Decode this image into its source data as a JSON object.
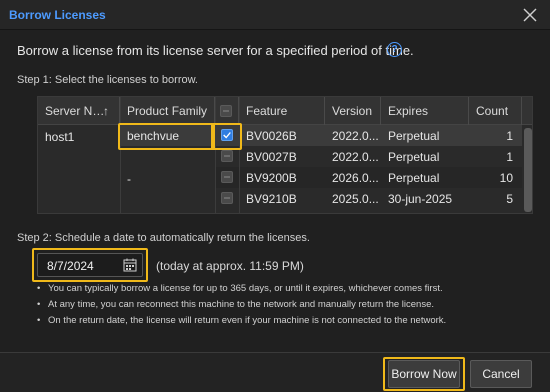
{
  "window": {
    "title": "Borrow Licenses",
    "close_icon": "close-icon"
  },
  "intro": {
    "text": "Borrow a license from its license server for a specified period of time.",
    "help_glyph": "?"
  },
  "step1": {
    "label": "Step 1: Select the licenses to borrow."
  },
  "table": {
    "headers": {
      "server": "Server N…",
      "sort_glyph": "↑",
      "product": "Product Family",
      "feature": "Feature",
      "version": "Version",
      "expires": "Expires",
      "count": "Count"
    },
    "server_cell": "host1",
    "product_cells": [
      "benchvue",
      "-"
    ],
    "rows": [
      {
        "feature": "BV0026B",
        "version": "2022.0...",
        "expires": "Perpetual",
        "count": "1",
        "checked": true
      },
      {
        "feature": "BV0027B",
        "version": "2022.0...",
        "expires": "Perpetual",
        "count": "1",
        "checked": false
      },
      {
        "feature": "BV9200B",
        "version": "2026.0...",
        "expires": "Perpetual",
        "count": "10",
        "checked": false
      },
      {
        "feature": "BV9210B",
        "version": "2025.0...",
        "expires": "30-jun-2025",
        "count": "5",
        "checked": false
      }
    ]
  },
  "step2": {
    "label": "Step 2: Schedule a date to automatically return the licenses.",
    "date_value": "8/7/2024",
    "today_note": "(today at approx. 11:59 PM)",
    "bullets": [
      "You can typically borrow a license for up to 365 days, or until it expires, whichever comes first.",
      "At any time, you can reconnect this machine to the network and manually return the license.",
      "On the return date, the license will return even if your machine is not connected to the network."
    ]
  },
  "buttons": {
    "borrow": "Borrow Now",
    "cancel": "Cancel"
  },
  "colors": {
    "accent": "#4d9bff",
    "highlight": "#f0b91a",
    "checkbox_on": "#2f7de1",
    "selected_row": "#3b3b3b"
  }
}
